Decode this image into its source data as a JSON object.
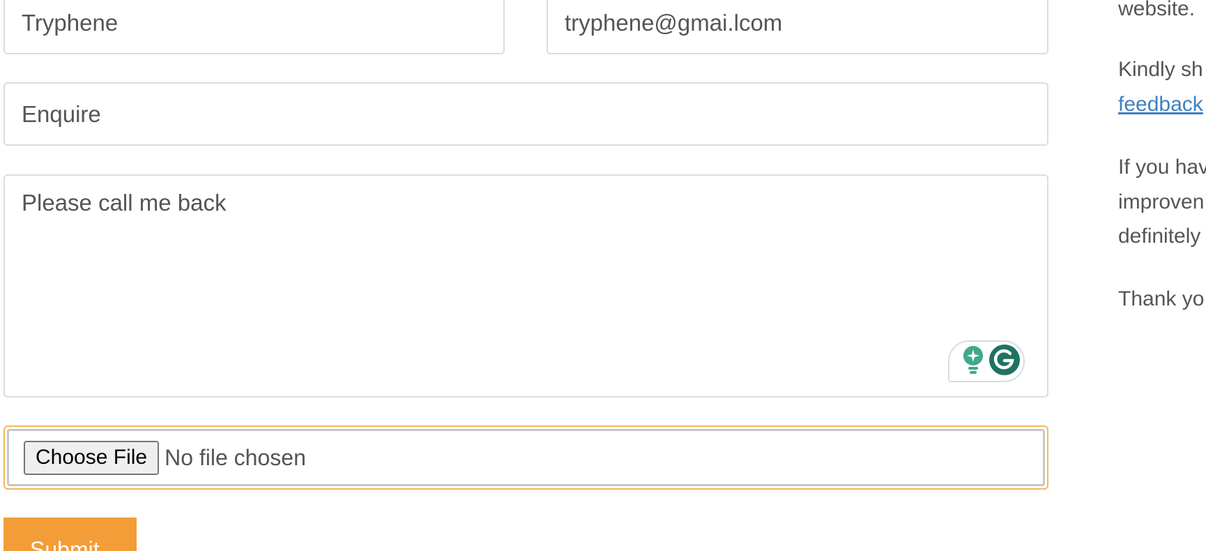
{
  "form": {
    "name_value": "Tryphene",
    "email_value": "tryphene@gmai.lcom",
    "subject_value": "Enquire",
    "message_value": "Please call me back",
    "file_button_label": "Choose File",
    "file_status": "No file chosen",
    "submit_label": "Submit"
  },
  "grammarly": {
    "icons": [
      "lightbulb-icon",
      "grammarly-g-icon"
    ],
    "colors": {
      "bulb": "#3fa98a",
      "g_badge": "#1f7360"
    }
  },
  "sidebar_text": {
    "line1": "website.",
    "line2": "Kindly sh",
    "link_text": "feedback",
    "line4": "If you hav",
    "line5": "improven",
    "line6": "definitely",
    "line7": "Thank yo"
  },
  "colors": {
    "accent": "#f29d38",
    "focus_border": "#f3b65f",
    "link": "#3d7fc4",
    "text": "#555555",
    "border": "#dcdcdc"
  }
}
